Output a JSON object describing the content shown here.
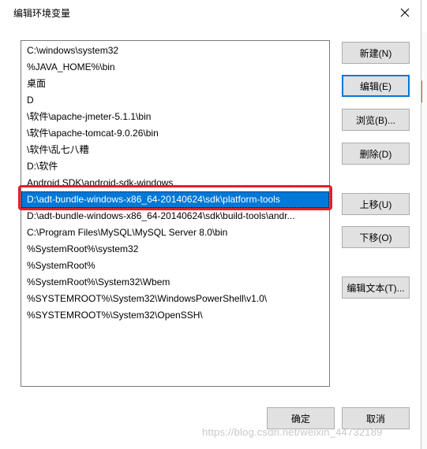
{
  "window": {
    "title": "编辑环境变量"
  },
  "paths": [
    "C:\\windows\\system32",
    "%JAVA_HOME%\\bin",
    "桌面",
    "D",
    "\\软件\\apache-jmeter-5.1.1\\bin",
    "\\软件\\apache-tomcat-9.0.26\\bin",
    "\\软件\\乱七八糟",
    "D:\\软件",
    "Android SDK\\android-sdk-windows",
    "D:\\adt-bundle-windows-x86_64-20140624\\sdk\\platform-tools",
    "D:\\adt-bundle-windows-x86_64-20140624\\sdk\\build-tools\\andr...",
    "C:\\Program Files\\MySQL\\MySQL Server 8.0\\bin",
    "%SystemRoot%\\system32",
    "%SystemRoot%",
    "%SystemRoot%\\System32\\Wbem",
    "%SYSTEMROOT%\\System32\\WindowsPowerShell\\v1.0\\",
    "%SYSTEMROOT%\\System32\\OpenSSH\\"
  ],
  "selected_index": 9,
  "buttons": {
    "new": "新建(N)",
    "edit": "编辑(E)",
    "browse": "浏览(B)...",
    "delete": "删除(D)",
    "move_up": "上移(U)",
    "move_down": "下移(O)",
    "edit_text": "编辑文本(T)...",
    "ok": "确定",
    "cancel": "取消"
  },
  "colors": {
    "selection": "#0078d7",
    "annotation_box": "#e0202a"
  },
  "watermark": "https://blog.csdn.net/weixin_44732189",
  "icons": {
    "close": "close-icon"
  }
}
